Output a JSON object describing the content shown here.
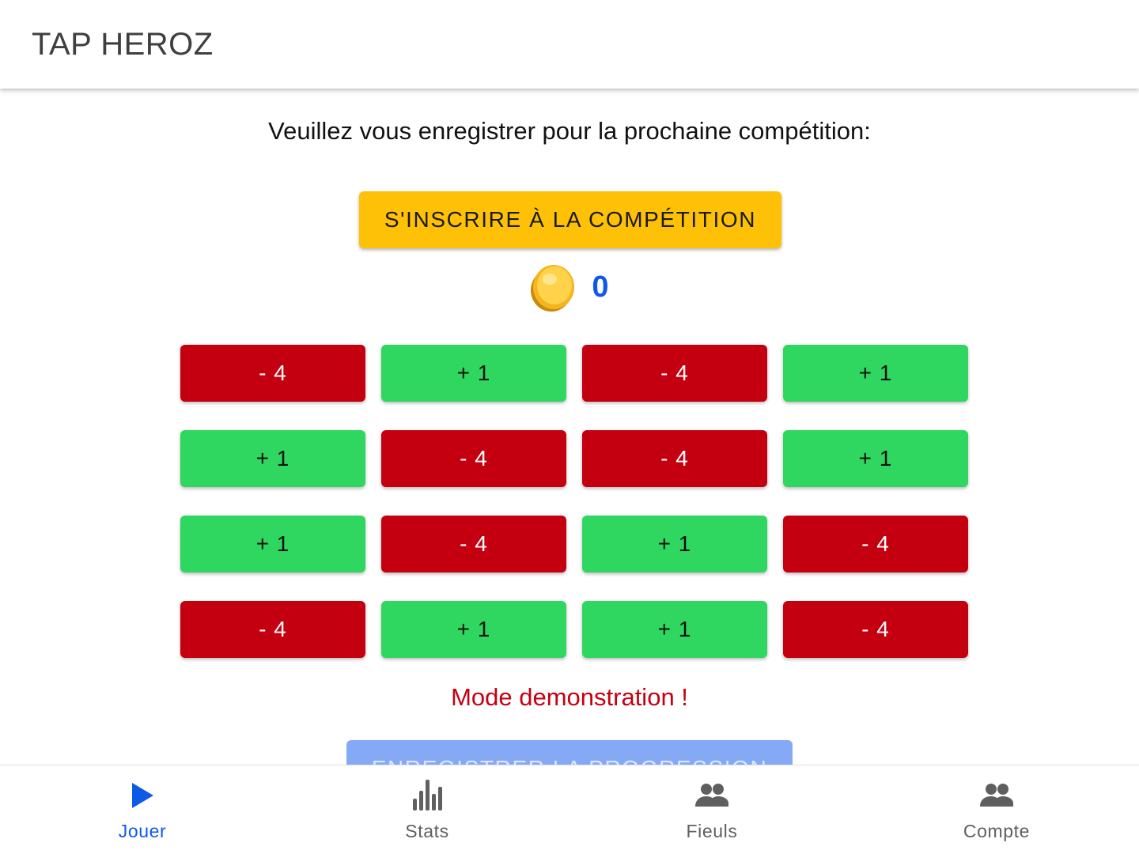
{
  "app": {
    "title": "TAP HEROZ"
  },
  "main": {
    "intro_text": "Veuillez vous enregistrer pour la prochaine compétition:",
    "register_button_label": "S'INSCRIRE À LA COMPÉTITION",
    "coin_icon": "gold-coin-icon",
    "coin_count": "0",
    "tiles": [
      {
        "label": "- 4",
        "color": "red"
      },
      {
        "label": "+ 1",
        "color": "green"
      },
      {
        "label": "- 4",
        "color": "red"
      },
      {
        "label": "+ 1",
        "color": "green"
      },
      {
        "label": "+ 1",
        "color": "green"
      },
      {
        "label": "- 4",
        "color": "red"
      },
      {
        "label": "- 4",
        "color": "red"
      },
      {
        "label": "+ 1",
        "color": "green"
      },
      {
        "label": "+ 1",
        "color": "green"
      },
      {
        "label": "- 4",
        "color": "red"
      },
      {
        "label": "+ 1",
        "color": "green"
      },
      {
        "label": "- 4",
        "color": "red"
      },
      {
        "label": "- 4",
        "color": "red"
      },
      {
        "label": "+ 1",
        "color": "green"
      },
      {
        "label": "+ 1",
        "color": "green"
      },
      {
        "label": "- 4",
        "color": "red"
      }
    ],
    "demo_note": "Mode demonstration !",
    "save_button_label": "ENREGISTRER LA PROGRESSION"
  },
  "bottom_nav": {
    "items": [
      {
        "label": "Jouer",
        "icon": "play-icon",
        "active": true
      },
      {
        "label": "Stats",
        "icon": "bar-chart-icon",
        "active": false
      },
      {
        "label": "Fieuls",
        "icon": "people-icon",
        "active": false
      },
      {
        "label": "Compte",
        "icon": "people-icon",
        "active": false
      }
    ]
  },
  "colors": {
    "accent": "#0d5ae8",
    "register_button": "#fec107",
    "tile_red": "#c40010",
    "tile_green": "#2fd65f",
    "demo_note": "#c40010",
    "save_button_disabled": "#86a9f5"
  }
}
